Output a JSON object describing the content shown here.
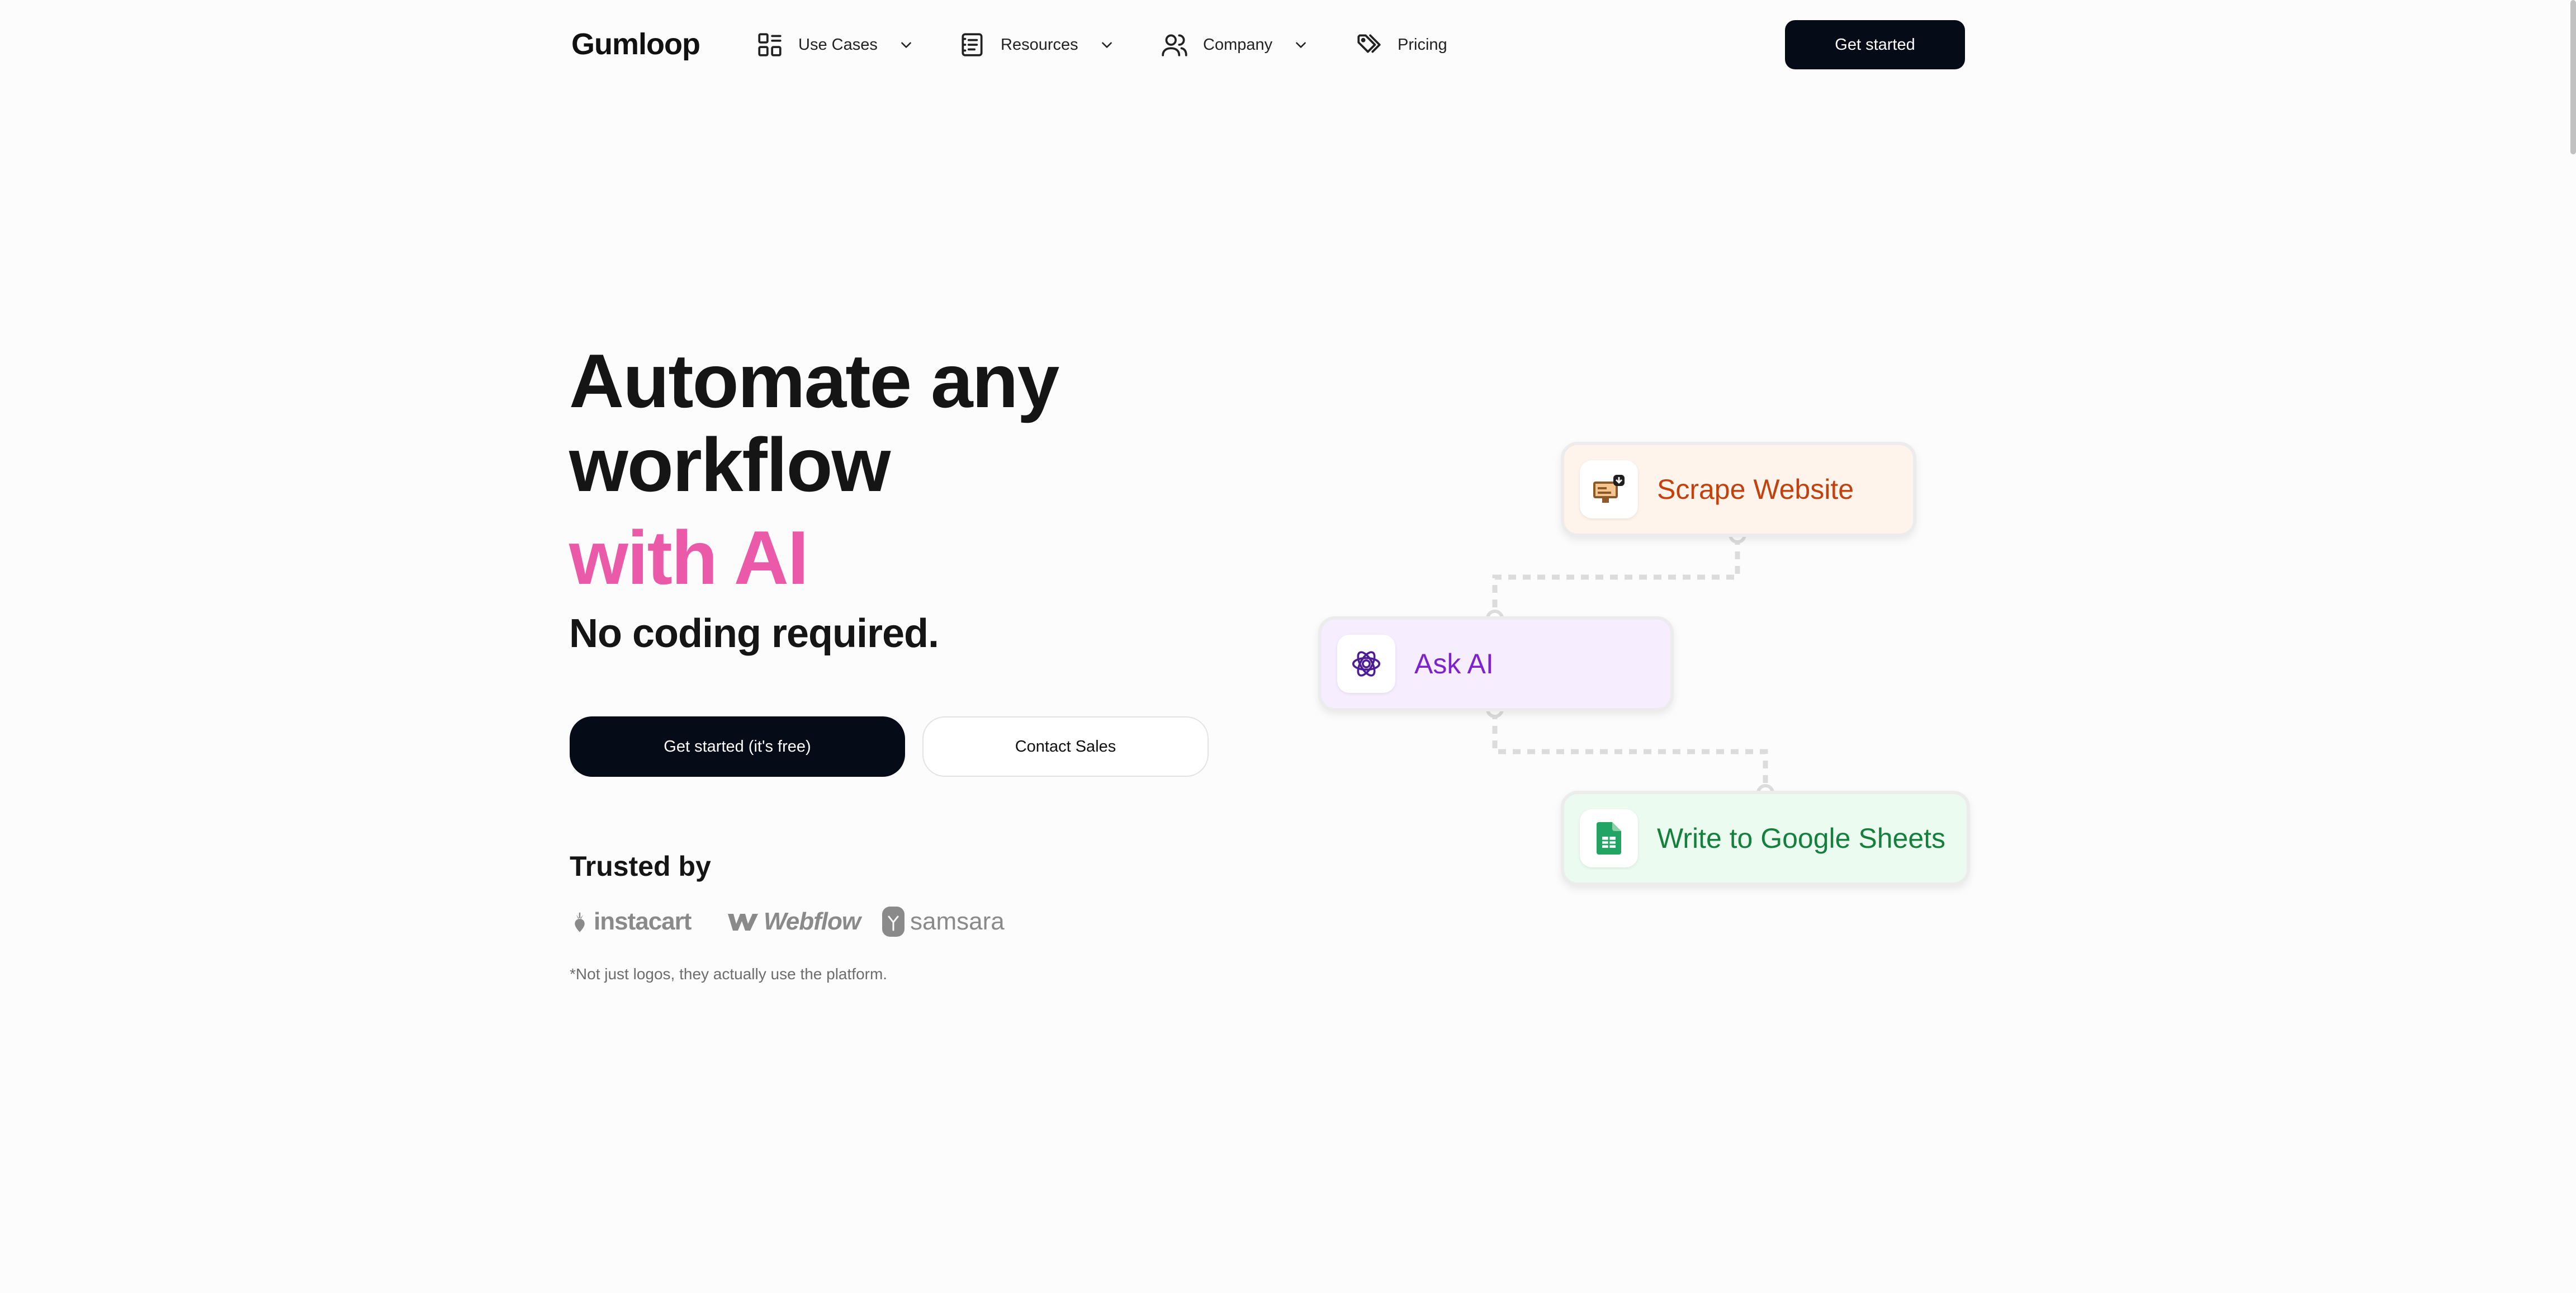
{
  "brand": {
    "name": "Gumloop"
  },
  "nav": {
    "items": [
      {
        "label": "Use Cases",
        "icon": "grid-icon",
        "has_dropdown": true
      },
      {
        "label": "Resources",
        "icon": "notebook-icon",
        "has_dropdown": true
      },
      {
        "label": "Company",
        "icon": "users-icon",
        "has_dropdown": true
      },
      {
        "label": "Pricing",
        "icon": "tags-icon",
        "has_dropdown": false
      }
    ],
    "cta_label": "Get started"
  },
  "hero": {
    "title_line1": "Automate any",
    "title_line2": "workflow",
    "title_accent": "with AI",
    "subtitle": "No coding required.",
    "primary_cta": "Get started (it's free)",
    "secondary_cta": "Contact Sales"
  },
  "trusted": {
    "heading": "Trusted by",
    "logos": [
      "instacart",
      "Webflow",
      "samsara"
    ],
    "footnote": "*Not just logos, they actually use the platform."
  },
  "workflow": {
    "nodes": [
      {
        "label": "Scrape Website",
        "icon": "scrape-website-icon"
      },
      {
        "label": "Ask AI",
        "icon": "openai-icon"
      },
      {
        "label": "Write to Google Sheets",
        "icon": "google-sheets-icon"
      }
    ]
  },
  "colors": {
    "accent": "#ea5aa8",
    "button_dark": "#060b18",
    "scrape": "#c2410c",
    "ask_ai": "#7e22ce",
    "sheets": "#15803d"
  }
}
